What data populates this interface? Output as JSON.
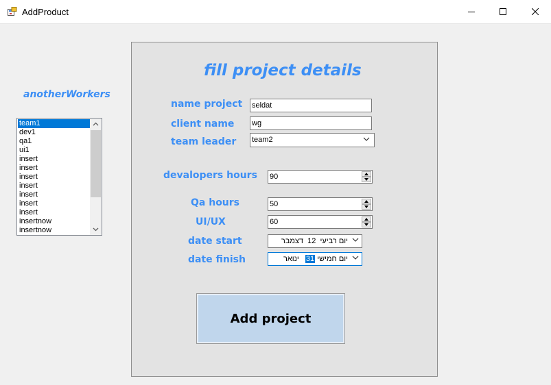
{
  "window": {
    "title": "AddProduct"
  },
  "side": {
    "heading": "anotherWorkers",
    "list": [
      "team1",
      "dev1",
      "qa1",
      "ui1",
      "insert",
      "insert",
      "insert",
      "insert",
      "insert",
      "insert",
      "insert",
      "insertnow",
      "insertnow"
    ],
    "selected_index": 0
  },
  "form": {
    "title": "fill project details",
    "name_project_label": "name project",
    "name_project_value": "seldat",
    "client_name_label": "client name",
    "client_name_value": "wg",
    "team_leader_label": "team leader",
    "team_leader_value": "team2",
    "dev_hours_label": "devalopers hours",
    "dev_hours_value": "90",
    "qa_hours_label": "Qa hours",
    "qa_hours_value": "50",
    "uiux_label": "UI/UX",
    "uiux_value": "60",
    "date_start_label": "date start",
    "date_start": {
      "weekday": "יום רביעי",
      "day": "12",
      "month": "דצמבר"
    },
    "date_finish_label": "date finish",
    "date_finish": {
      "weekday": "יום חמישי",
      "day": "31",
      "month": "ינואר"
    },
    "add_button": "Add project"
  },
  "colors": {
    "accent": "#3d8ff5",
    "selection": "#0078d7",
    "button": "#c0d6ec"
  }
}
